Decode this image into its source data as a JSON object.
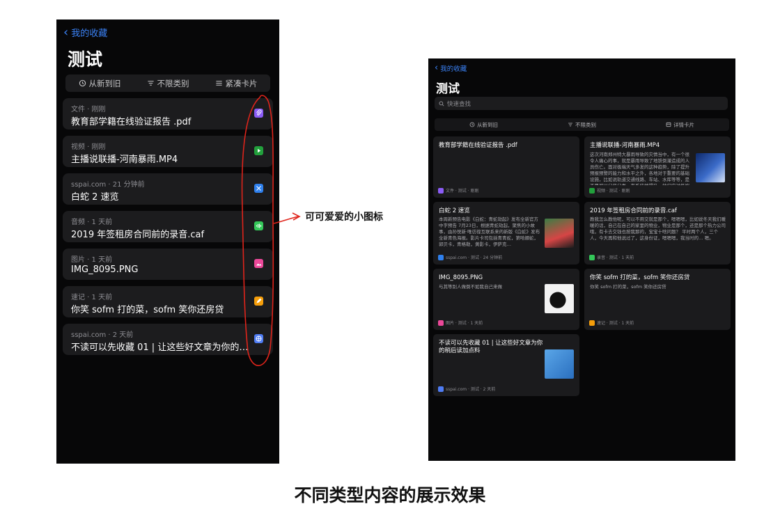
{
  "phone": {
    "back_label": "我的收藏",
    "title": "测试",
    "filters": [
      {
        "label": "从新到旧",
        "icon": "clock-icon"
      },
      {
        "label": "不限类别",
        "icon": "filter-icon"
      },
      {
        "label": "紧凑卡片",
        "icon": "list-icon"
      }
    ],
    "items": [
      {
        "meta": "文件 · 刚刚",
        "name": "教育部学籍在线验证报告 .pdf",
        "icon": "paperclip-icon",
        "color": "#8b5cf6"
      },
      {
        "meta": "视频 · 刚刚",
        "name": "主播说联播-河南暴雨.MP4",
        "icon": "play-icon",
        "color": "#22a03c"
      },
      {
        "meta": "sspai.com · 21 分钟前",
        "name": "白蛇 2 速览",
        "icon": "scissors-icon",
        "color": "#2f80ed"
      },
      {
        "meta": "音频 · 1 天前",
        "name": "2019 年签租房合同前的录音.caf",
        "icon": "waveform-icon",
        "color": "#34c759"
      },
      {
        "meta": "图片 · 1 天前",
        "name": "IMG_8095.PNG",
        "icon": "image-icon",
        "color": "#ec4899"
      },
      {
        "meta": "速记 · 1 天前",
        "name": "你笑 sofm 打的菜，sofm 笑你还房贷",
        "icon": "pencil-icon",
        "color": "#f59e0b"
      },
      {
        "meta": "sspai.com · 2 天前",
        "name": "不读可以先收藏 01 | 让这些好文章为你的稍后读加点料",
        "icon": "globe-icon",
        "color": "#4f7cf3"
      }
    ]
  },
  "annotation": {
    "label": "可可爱爱的小图标"
  },
  "tablet": {
    "back_label": "我的收藏",
    "title": "测试",
    "search_placeholder": "快速查找",
    "filters": [
      {
        "label": "从新到旧",
        "icon": "clock-icon"
      },
      {
        "label": "不限类别",
        "icon": "filter-icon"
      },
      {
        "label": "详情卡片",
        "icon": "card-icon"
      }
    ],
    "cards": [
      {
        "title": "教育部学籍在线验证报告 .pdf",
        "desc": "",
        "footer": "文件 · 测试 · 刚刚",
        "icon_color": "#8b5cf6",
        "has_thumb": false
      },
      {
        "title": "主播说联播-河南暴雨.MP4",
        "desc": "这次河南郑州特大暴雨导致的灾情当中，有一个很令人痛心的事，就是暴雨导致了地铁倒灌造成的人员伤亡。面对极端天气多发的这种趋势，除了提升预报预警的能力和水平之外，各地对于重要的基础设施，比如说轨道交通线路、车站、水库等等，是不是可以分级分类，有系统地提升。他们应对极端天气的能力…",
        "footer": "视频 · 测试 · 刚刚",
        "icon_color": "#22a03c",
        "has_thumb": true
      },
      {
        "title": "白蛇 2 速览",
        "desc": "本周新预告电影《白蛇：青蛇劫起》发布全新官方中字预告 7月23日，根据青蛇劫起，聚焦的小故事，由孙悦新·唯彷徨互联系来的新版《白蛇》发布全新青色海报。影片卡司包括青青蛇，第哈娜蛇，郭贝卡，青格勒，黄影卡，伊萨克…",
        "footer": "sspai.com · 测试 · 24 分钟前",
        "icon_color": "#2f80ed",
        "has_thumb": true
      },
      {
        "title": "2019 年签租房合同前的录音.caf",
        "desc": "教我怎么教他呢，可以不用交就是那个，嗯嗯嗯，比如说冬天我们暖暖的话，自己在自己的家里的物业，物业是那个，还是那个热力公司哦，有卡去交钱也按我那的，宝宝十啥问题？ 平时两个人，三个人，今天再和他说过了，这身份证，嗯嗯嗯，我当时的… 嗯。",
        "footer": "录音 · 测试 · 1 天前",
        "icon_color": "#34c759",
        "has_thumb": false
      },
      {
        "title": "IMG_8095.PNG",
        "desc": "与其等别人做倒不如我自己来做",
        "footer": "图片 · 测试 · 1 天前",
        "icon_color": "#ec4899",
        "has_thumb": true
      },
      {
        "title": "你笑 sofm 打的菜，sofm 笑你还房贷",
        "desc": "你笑 sofm 打的菜，sofm 笑你还房贷",
        "footer": "速记 · 测试 · 1 天前",
        "icon_color": "#f59e0b",
        "has_thumb": false
      },
      {
        "title": "不读可以先收藏 01 | 让这些好文章为你的稍后读加点料",
        "desc": "",
        "footer": "sspai.com · 测试 · 2 天前",
        "icon_color": "#4f7cf3",
        "has_thumb": true
      }
    ]
  },
  "caption": "不同类型内容的展示效果"
}
